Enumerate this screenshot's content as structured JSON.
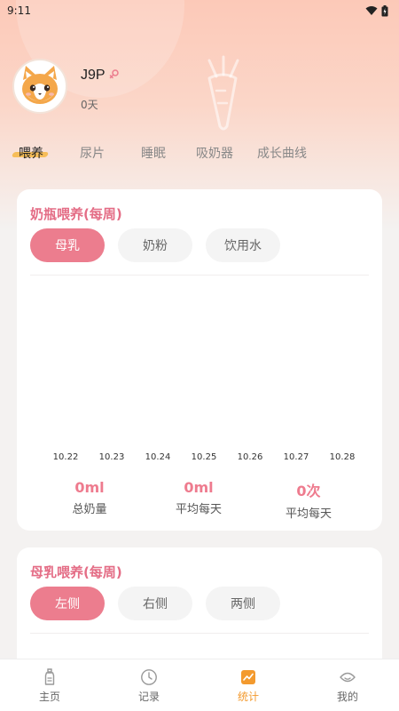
{
  "status_bar": {
    "time": "9:11"
  },
  "profile": {
    "name": "J9P",
    "age": "0天"
  },
  "tabs": [
    "喂养",
    "尿片",
    "睡眠",
    "吸奶器",
    "成长曲线"
  ],
  "bottle_card": {
    "title": "奶瓶喂养(每周)",
    "buttons": [
      "母乳",
      "奶粉",
      "饮用水"
    ],
    "stats": [
      {
        "value": "0ml",
        "label": "总奶量"
      },
      {
        "value": "0ml",
        "label": "平均每天"
      },
      {
        "value": "0次",
        "label": "平均每天"
      }
    ]
  },
  "chart_data": {
    "type": "bar",
    "categories": [
      "10.22",
      "10.23",
      "10.24",
      "10.25",
      "10.26",
      "10.27",
      "10.28"
    ],
    "values": [
      0,
      0,
      0,
      0,
      0,
      0,
      0
    ]
  },
  "breast_card": {
    "title": "母乳喂养(每周)",
    "buttons": [
      "左侧",
      "右侧",
      "两侧"
    ]
  },
  "bottom_nav": [
    {
      "label": "主页",
      "icon": "bottle-icon"
    },
    {
      "label": "记录",
      "icon": "clock-icon"
    },
    {
      "label": "统计",
      "icon": "chart-icon"
    },
    {
      "label": "我的",
      "icon": "face-icon"
    }
  ],
  "colors": {
    "accent_pink": "#ec7d8e",
    "title_pink": "#e46d86",
    "active_orange": "#f39a2e"
  }
}
